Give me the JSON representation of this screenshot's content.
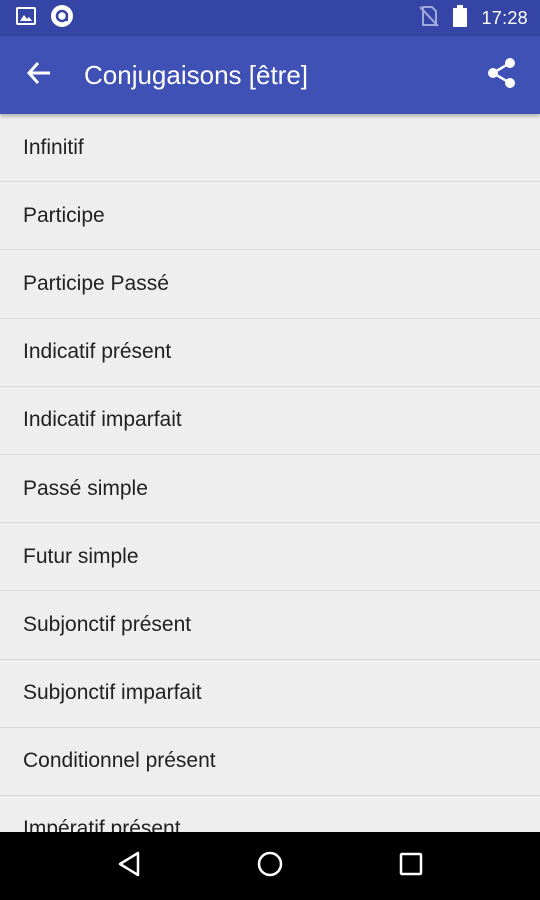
{
  "status_bar": {
    "time": "17:28",
    "icons_left": [
      "image-notification-icon",
      "app-notification-icon"
    ],
    "icons_right": [
      "no-sim-icon",
      "battery-icon"
    ]
  },
  "app_bar": {
    "title": "Conjugaisons [être]",
    "color": "#3f51b5",
    "back_icon": "arrow-back-icon",
    "share_icon": "share-icon"
  },
  "list": {
    "items": [
      "Infinitif",
      "Participe",
      "Participe Passé",
      "Indicatif présent",
      "Indicatif imparfait",
      "Passé simple",
      "Futur simple",
      "Subjonctif présent",
      "Subjonctif imparfait",
      "Conditionnel présent",
      "Impératif présent"
    ]
  },
  "nav_bar": {
    "buttons": [
      "back-triangle-icon",
      "home-circle-icon",
      "recents-square-icon"
    ]
  }
}
